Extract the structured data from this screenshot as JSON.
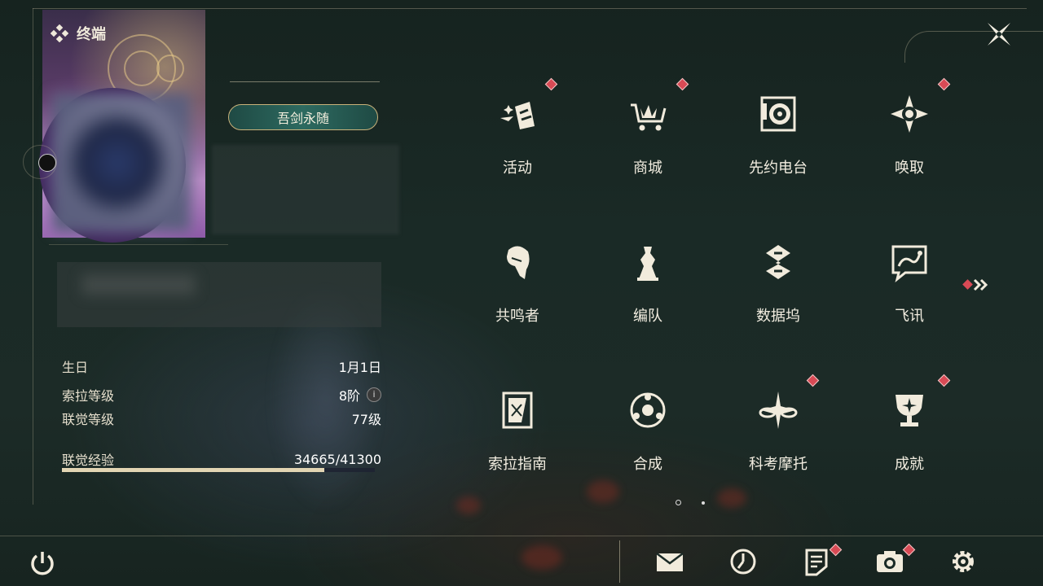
{
  "header": {
    "title": "终端"
  },
  "profile": {
    "title_badge": "吾剑永随",
    "stats": [
      {
        "label": "生日",
        "value": "1月1日"
      },
      {
        "label": "索拉等级",
        "value": "8阶"
      },
      {
        "label": "联觉等级",
        "value": "77级"
      },
      {
        "label": "联觉经验",
        "value": "34665/41300"
      }
    ],
    "exp_progress": 0.839
  },
  "menu": [
    {
      "label": "活动",
      "icon": "activity-icon",
      "badge": true
    },
    {
      "label": "商城",
      "icon": "shop-cart-icon",
      "badge": true
    },
    {
      "label": "先约电台",
      "icon": "radio-icon",
      "badge": false
    },
    {
      "label": "唤取",
      "icon": "convene-icon",
      "badge": true
    },
    {
      "label": "共鸣者",
      "icon": "resonator-icon",
      "badge": false
    },
    {
      "label": "编队",
      "icon": "team-icon",
      "badge": false
    },
    {
      "label": "数据坞",
      "icon": "data-bank-icon",
      "badge": false
    },
    {
      "label": "飞讯",
      "icon": "message-icon",
      "badge": false
    },
    {
      "label": "索拉指南",
      "icon": "guide-icon",
      "badge": false
    },
    {
      "label": "合成",
      "icon": "synthesis-icon",
      "badge": false
    },
    {
      "label": "科考摩托",
      "icon": "motorcycle-icon",
      "badge": true
    },
    {
      "label": "成就",
      "icon": "achievement-icon",
      "badge": true
    }
  ],
  "pagination": {
    "pages": 2,
    "current": 1
  },
  "colors": {
    "badge": "#d84a55",
    "accent": "#e2d5b3",
    "background": "#1a2a26"
  },
  "bottom_bar": [
    "mail-icon",
    "clock-icon",
    "notice-icon",
    "camera-icon",
    "settings-icon"
  ]
}
